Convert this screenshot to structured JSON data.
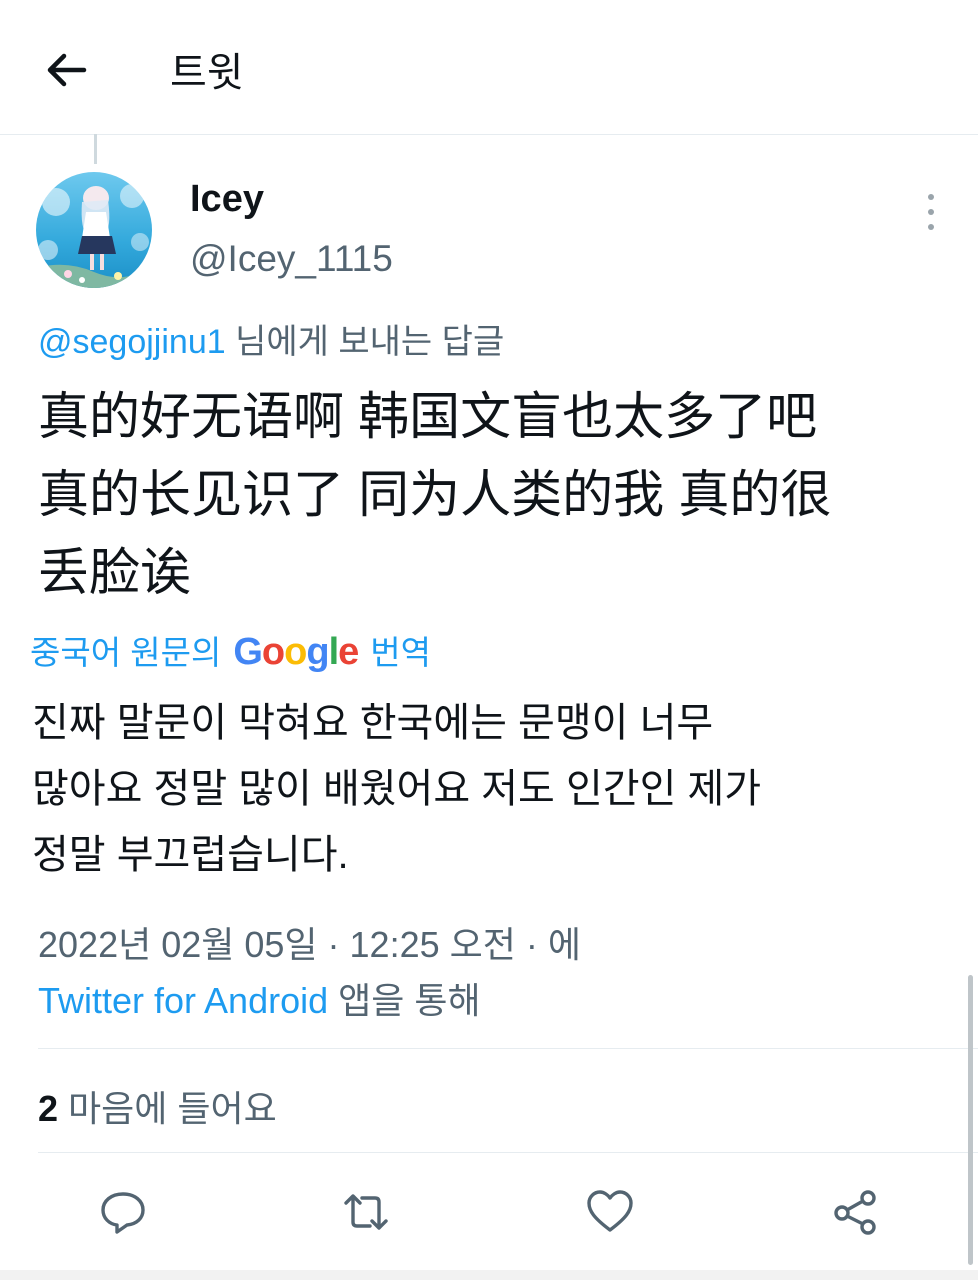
{
  "header": {
    "title": "트윗"
  },
  "author": {
    "name": "Icey",
    "handle": "@Icey_1115"
  },
  "reply": {
    "mention": "@segojjinu1",
    "suffix": " 님에게 보내는 답글"
  },
  "tweet": {
    "lines": [
      "真的好无语啊 韩国文盲也太多了吧",
      "真的长见识了 同为人类的我 真的很",
      "丢脸诶"
    ]
  },
  "translate": {
    "prefix": "중국어 원문의",
    "brand_letters": [
      "G",
      "o",
      "o",
      "g",
      "l",
      "e"
    ],
    "suffix": "번역"
  },
  "translation": {
    "lines": [
      "진짜 말문이 막혀요 한국에는 문맹이 너무",
      "많아요 정말 많이 배웠어요 저도 인간인 제가",
      "정말 부끄럽습니다."
    ]
  },
  "meta": {
    "timestamp": "2022년 02월 05일 · 12:25 오전 · 에",
    "source_app": "Twitter for Android",
    "source_suffix": " 앱을 통해"
  },
  "stats": {
    "likes_count": "2",
    "likes_label": " 마음에 들어요"
  },
  "actions": [
    "reply-icon",
    "retweet-icon",
    "like-icon",
    "share-icon"
  ],
  "colors": {
    "accent": "#1d9bf0",
    "text": "#0f1419",
    "secondary": "#536471",
    "divider": "#e6ecf0"
  }
}
